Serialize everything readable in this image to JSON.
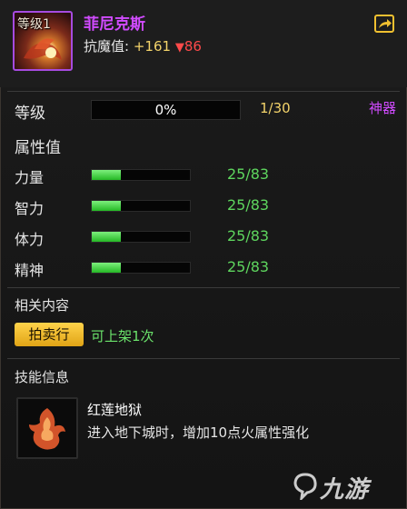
{
  "header": {
    "level_tag": "等级1",
    "name": "菲尼克斯",
    "resist_label": "抗魔值:",
    "resist_bonus": "+161",
    "resist_drop_icon": "red-down-triangle",
    "resist_drop": "86",
    "share_icon": "share-arrow-icon"
  },
  "level": {
    "label": "等级",
    "progress_text": "0%",
    "progress": 0,
    "count": "1/30",
    "rarity": "神器"
  },
  "attributes": {
    "title": "属性值",
    "items": [
      {
        "label": "力量",
        "value": "25/83",
        "fill": 0.3
      },
      {
        "label": "智力",
        "value": "25/83",
        "fill": 0.3
      },
      {
        "label": "体力",
        "value": "25/83",
        "fill": 0.3
      },
      {
        "label": "精神",
        "value": "25/83",
        "fill": 0.3
      }
    ]
  },
  "related": {
    "title": "相关内容",
    "auction_button": "拍卖行",
    "auction_note": "可上架1次"
  },
  "skills": {
    "title": "技能信息",
    "name": "红莲地狱",
    "description": "进入地下城时，增加10点火属性强化",
    "icon": "phoenix-fire-icon"
  },
  "watermark": {
    "text": "九游",
    "logo": "jiuyou-logo"
  },
  "colors": {
    "rarity": "#d14bff",
    "stat_value": "#5ed65e",
    "gold": "#f3d36a",
    "negative": "#ff4a4a",
    "button": "#f5b92a"
  }
}
